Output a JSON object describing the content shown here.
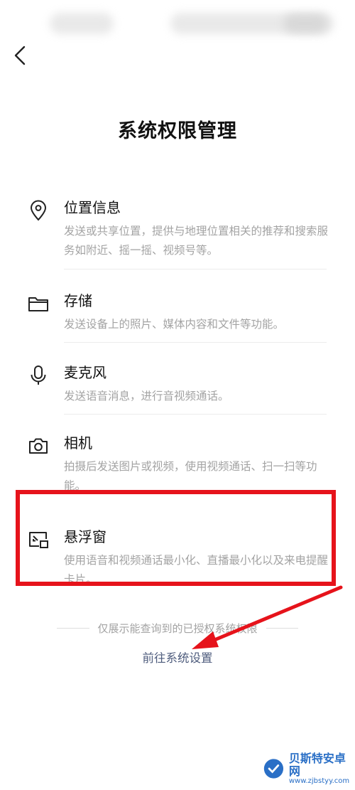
{
  "header": {
    "title": "系统权限管理"
  },
  "permissions": [
    {
      "name": "位置信息",
      "desc": "发送或共享位置，提供与地理位置相关的推荐和搜索服务如附近、摇一摇、视频号等。",
      "icon": "location-pin-icon"
    },
    {
      "name": "存储",
      "desc": "发送设备上的照片、媒体内容和文件等功能。",
      "icon": "folder-icon"
    },
    {
      "name": "麦克风",
      "desc": "发送语音消息，进行音视频通话。",
      "icon": "microphone-icon"
    },
    {
      "name": "相机",
      "desc": "拍摄后发送图片或视频，使用视频通话、扫一扫等功能。",
      "icon": "camera-icon"
    },
    {
      "name": "悬浮窗",
      "desc": "使用语音和视频通话最小化、直播最小化以及来电提醒卡片。",
      "icon": "floating-window-icon"
    }
  ],
  "footer": {
    "note": "仅展示能查询到的已授权系统权限",
    "link": "前往系统设置"
  },
  "annotation": {
    "highlight_color": "#e6131b"
  },
  "watermark": {
    "title": "贝斯特安卓网",
    "url": "www.zjbstyy.com"
  }
}
